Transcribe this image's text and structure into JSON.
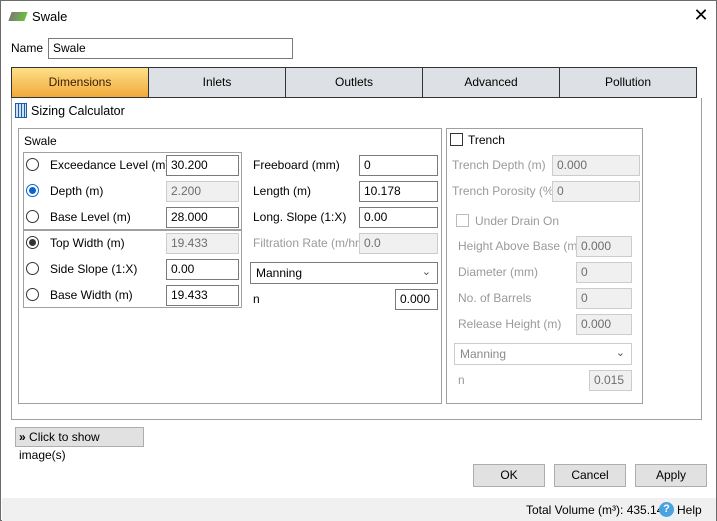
{
  "window": {
    "title": "Swale",
    "close": "✕"
  },
  "name": {
    "label": "Name",
    "value": "Swale"
  },
  "tabs": [
    {
      "label": "Dimensions",
      "active": true
    },
    {
      "label": "Inlets"
    },
    {
      "label": "Outlets"
    },
    {
      "label": "Advanced"
    },
    {
      "label": "Pollution"
    }
  ],
  "sizing_calculator": "Sizing Calculator",
  "swale": {
    "title": "Swale",
    "left": [
      {
        "label": "Exceedance Level (m)",
        "value": "30.200",
        "selected": false,
        "disabled": false
      },
      {
        "label": "Depth (m)",
        "value": "2.200",
        "selected": true,
        "disabled": true
      },
      {
        "label": "Base Level (m)",
        "value": "28.000",
        "selected": false,
        "disabled": false
      },
      {
        "label": "Top Width (m)",
        "value": "19.433",
        "selected": true,
        "disabled": true
      },
      {
        "label": "Side Slope (1:X)",
        "value": "0.00",
        "selected": false,
        "disabled": false
      },
      {
        "label": "Base Width (m)",
        "value": "19.433",
        "selected": false,
        "disabled": false
      }
    ],
    "right": [
      {
        "label": "Freeboard (mm)",
        "value": "0"
      },
      {
        "label": "Length (m)",
        "value": "10.178"
      },
      {
        "label": "Long. Slope (1:X)",
        "value": "0.00"
      },
      {
        "label": "Filtration Rate (m/hr)",
        "value": "0.0",
        "disabled": true
      }
    ],
    "roughness_method": "Manning",
    "n_label": "n",
    "n_value": "0.000"
  },
  "trench": {
    "label": "Trench",
    "checked": false,
    "fields": [
      {
        "label": "Trench Depth (m)",
        "value": "0.000"
      },
      {
        "label": "Trench Porosity (%)",
        "value": "0"
      }
    ],
    "under_drain": {
      "label": "Under Drain On",
      "checked": false
    },
    "drain_fields": [
      {
        "label": "Height Above Base (m)",
        "value": "0.000"
      },
      {
        "label": "Diameter (mm)",
        "value": "0"
      },
      {
        "label": "No. of Barrels",
        "value": "0"
      },
      {
        "label": "Release Height (m)",
        "value": "0.000"
      }
    ],
    "roughness_method": "Manning",
    "n_label": "n",
    "n_value": "0.015"
  },
  "show_images": "Click to show image(s)",
  "buttons": {
    "ok": "OK",
    "cancel": "Cancel",
    "apply": "Apply"
  },
  "status": {
    "total_volume": "Total Volume (m³): 435.145",
    "help": "Help"
  },
  "colors": {
    "active_tab_top": "#fde08a",
    "active_tab_bottom": "#f2a93a",
    "radio_selected": "#0a64d0"
  }
}
